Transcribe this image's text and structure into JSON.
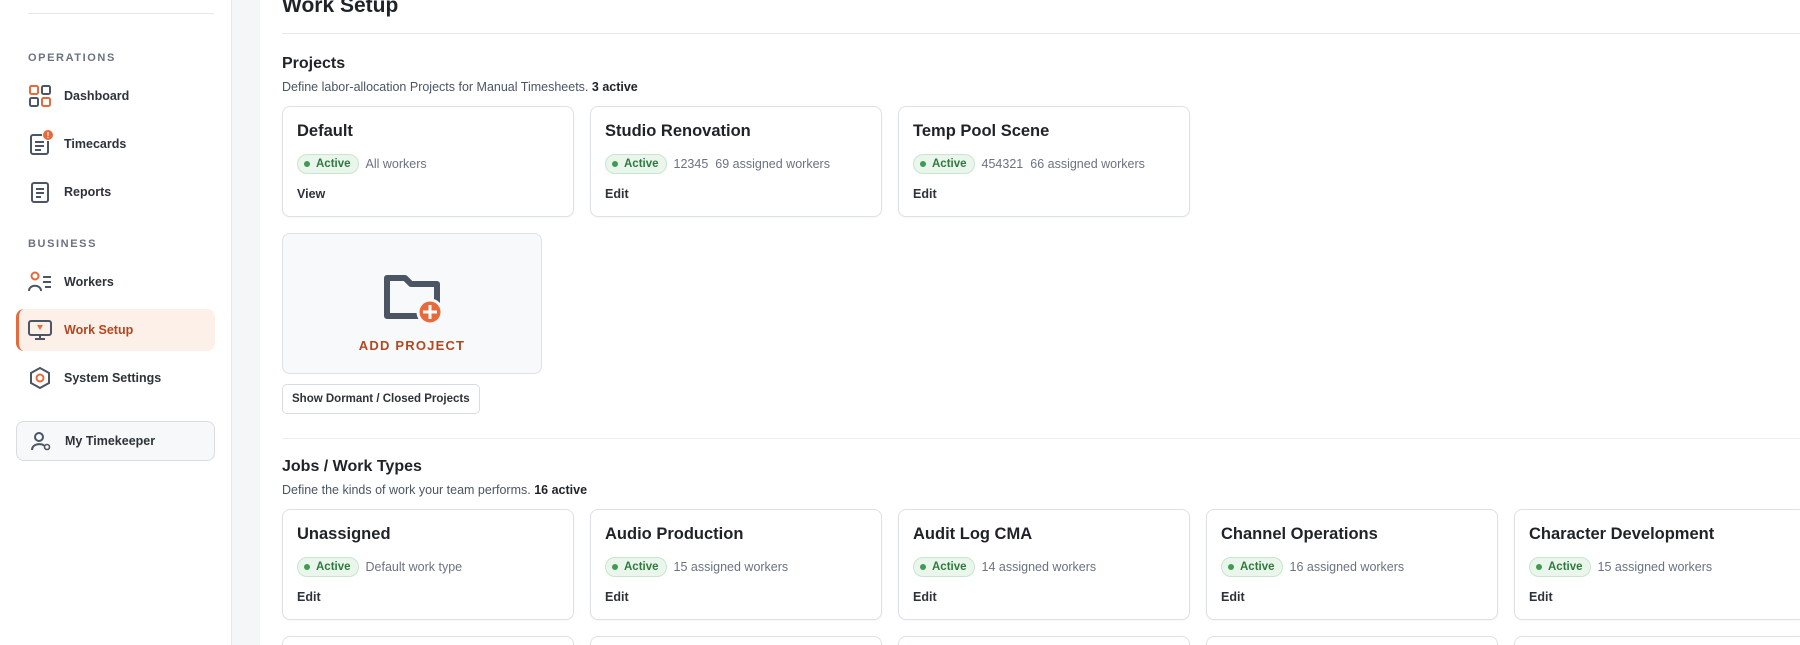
{
  "sidebar": {
    "sections": [
      {
        "label": "OPERATIONS"
      },
      {
        "label": "BUSINESS"
      }
    ],
    "items": [
      {
        "label": "Dashboard",
        "icon": "dashboard-grid-icon"
      },
      {
        "label": "Timecards",
        "icon": "timecard-icon",
        "badge": "!"
      },
      {
        "label": "Reports",
        "icon": "report-icon"
      },
      {
        "label": "Workers",
        "icon": "workers-icon"
      },
      {
        "label": "Work Setup",
        "icon": "monitor-icon",
        "active": true
      },
      {
        "label": "System Settings",
        "icon": "settings-hex-icon"
      }
    ],
    "timekeeper_label": "My Timekeeper"
  },
  "page": {
    "title": "Work Setup"
  },
  "projects": {
    "title": "Projects",
    "description": "Define labor-allocation Projects for Manual Timesheets.",
    "active_count": "3 active",
    "cards": [
      {
        "title": "Default",
        "status": "Active",
        "code": "",
        "detail": "All workers",
        "action": "View"
      },
      {
        "title": "Studio Renovation",
        "status": "Active",
        "code": "12345",
        "detail": "69 assigned workers",
        "action": "Edit"
      },
      {
        "title": "Temp Pool Scene",
        "status": "Active",
        "code": "454321",
        "detail": "66 assigned workers",
        "action": "Edit"
      }
    ],
    "add_label": "ADD PROJECT",
    "show_dormant_label": "Show Dormant / Closed Projects"
  },
  "jobs": {
    "title": "Jobs / Work Types",
    "description": "Define the kinds of work your team performs.",
    "active_count": "16 active",
    "cards": [
      {
        "title": "Unassigned",
        "status": "Active",
        "detail": "Default work type",
        "action": "Edit"
      },
      {
        "title": "Audio Production",
        "status": "Active",
        "detail": "15 assigned workers",
        "action": "Edit"
      },
      {
        "title": "Audit Log CMA",
        "status": "Active",
        "detail": "14 assigned workers",
        "action": "Edit"
      },
      {
        "title": "Channel Operations",
        "status": "Active",
        "detail": "16 assigned workers",
        "action": "Edit"
      },
      {
        "title": "Character Development",
        "status": "Active",
        "detail": "15 assigned workers",
        "action": "Edit"
      }
    ]
  },
  "colors": {
    "accent": "#e8693a",
    "accent_text": "#b4471e",
    "active_bg": "#eaf6ec",
    "active_text": "#2e7a3e"
  }
}
